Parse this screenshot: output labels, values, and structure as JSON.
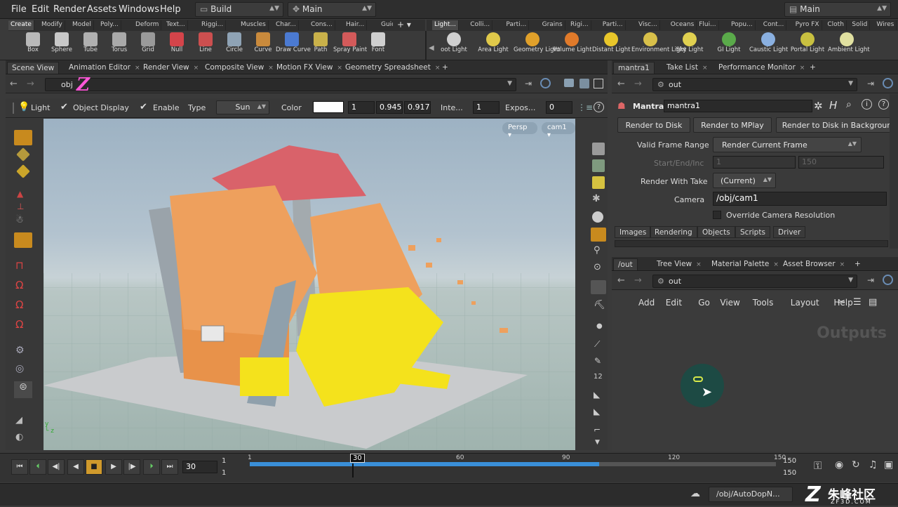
{
  "menu": [
    "File",
    "Edit",
    "Render",
    "Assets",
    "Windows",
    "Help"
  ],
  "desktop": {
    "value": "Build"
  },
  "context": {
    "value": "Main"
  },
  "desktop_right": {
    "value": "Main"
  },
  "shelf_tabs_left": [
    "Create",
    "Modify",
    "Model",
    "Poly...",
    "Deform",
    "Text...",
    "Riggi...",
    "Muscles",
    "Char...",
    "Cons...",
    "Hair...",
    "Guid..."
  ],
  "shelf_tabs_right": [
    "Light...",
    "Colli...",
    "Parti...",
    "Grains",
    "Rigi...",
    "Parti...",
    "Visc...",
    "Oceans",
    "Flui...",
    "Popu...",
    "Cont...",
    "Pyro FX",
    "Cloth",
    "Solid",
    "Wires"
  ],
  "tools_left": [
    {
      "label": "Box",
      "icon": "box-icon",
      "color": "#b9b9b9"
    },
    {
      "label": "Sphere",
      "icon": "sphere-icon",
      "color": "#c9c9c9"
    },
    {
      "label": "Tube",
      "icon": "tube-icon",
      "color": "#b0b0b0"
    },
    {
      "label": "Torus",
      "icon": "torus-icon",
      "color": "#a9a9a9"
    },
    {
      "label": "Grid",
      "icon": "grid-icon",
      "color": "#9a9a9a"
    },
    {
      "label": "Null",
      "icon": "null-icon",
      "color": "#d4444a"
    },
    {
      "label": "Line",
      "icon": "line-icon",
      "color": "#cc4f4f"
    },
    {
      "label": "Circle",
      "icon": "circle-icon",
      "color": "#8fa3b5"
    },
    {
      "label": "Curve",
      "icon": "curve-icon",
      "color": "#c98a3c"
    },
    {
      "label": "Draw Curve",
      "icon": "draw-curve-icon",
      "color": "#4b7ad1"
    },
    {
      "label": "Path",
      "icon": "path-icon",
      "color": "#c9b14a"
    },
    {
      "label": "Spray Paint",
      "icon": "spray-paint-icon",
      "color": "#d35a5a"
    },
    {
      "label": "Font",
      "icon": "font-icon",
      "color": "#cfcfcf"
    }
  ],
  "tools_right": [
    {
      "label": "oot Light",
      "icon": "spot-light-icon",
      "color": "#cfcfcf"
    },
    {
      "label": "Area Light",
      "icon": "area-light-icon",
      "color": "#e0c94a"
    },
    {
      "label": "Geometry Light",
      "icon": "geometry-light-icon",
      "color": "#e0a02a"
    },
    {
      "label": "Volume Light",
      "icon": "volume-light-icon",
      "color": "#e07a2a"
    },
    {
      "label": "Distant Light",
      "icon": "distant-light-icon",
      "color": "#e8c62a"
    },
    {
      "label": "Environment Light",
      "icon": "environment-light-icon",
      "color": "#d8c04a"
    },
    {
      "label": "Sky Light",
      "icon": "sky-light-icon",
      "color": "#e0d050"
    },
    {
      "label": "GI Light",
      "icon": "gi-light-icon",
      "color": "#5aaa4a"
    },
    {
      "label": "Caustic Light",
      "icon": "caustic-light-icon",
      "color": "#8ab0e0"
    },
    {
      "label": "Portal Light",
      "icon": "portal-light-icon",
      "color": "#c8c040"
    },
    {
      "label": "Ambient Light",
      "icon": "ambient-light-icon",
      "color": "#e0e0a0"
    }
  ],
  "left_tabs": [
    "Scene View",
    "Animation Editor",
    "Render View",
    "Composite View",
    "Motion FX View",
    "Geometry Spreadsheet"
  ],
  "left_path": "obj",
  "left_path_overlay": "Z",
  "light_bar": {
    "title": "Light",
    "object_display": "Object Display",
    "enable": "Enable",
    "type_label": "Type",
    "type_value": "Sun",
    "color_label": "Color",
    "color_r": "1",
    "color_g": "0.945",
    "color_b": "0.917",
    "intensity_label": "Inte...",
    "intensity_value": "1",
    "exposure_label": "Expos...",
    "exposure_value": "0"
  },
  "viewport": {
    "persp": "Persp",
    "cam": "cam1"
  },
  "right_top_tabs": [
    "mantra1",
    "Take List",
    "Performance Monitor"
  ],
  "right_top_path": "out",
  "mantra": {
    "type_label": "Mantra",
    "node_name": "mantra1",
    "buttons": [
      "Render to Disk",
      "Render to MPlay",
      "Render to Disk in Backgroun"
    ],
    "valid_frame_range_label": "Valid Frame Range",
    "valid_frame_range_value": "Render Current Frame",
    "start_end_label": "Start/End/Inc",
    "start_value": "1",
    "end_value": "150",
    "render_with_take_label": "Render With Take",
    "render_with_take_value": "(Current)",
    "camera_label": "Camera",
    "camera_value": "/obj/cam1",
    "override_label": "Override Camera Resolution",
    "subtabs": [
      "Images",
      "Rendering",
      "Objects",
      "Scripts",
      "Driver"
    ]
  },
  "right_bottom_tabs": [
    "/out",
    "Tree View",
    "Material Palette",
    "Asset Browser"
  ],
  "right_bottom_path": "out",
  "network_menu": [
    "Add",
    "Edit",
    "Go",
    "View",
    "Tools",
    "Layout",
    "Help"
  ],
  "network_watermark": "Outputs",
  "timeline": {
    "current_frame": "30",
    "start_frame": "1",
    "start_frame2": "1",
    "end_frame": "150",
    "end_frame2": "150",
    "ticks": [
      "1",
      "30",
      "60",
      "90",
      "120",
      "150"
    ],
    "ticks_values": [
      1,
      30,
      60,
      90,
      120,
      150
    ],
    "range_start": 1,
    "range_end": 150,
    "cached_end": 100,
    "current": 30
  },
  "status": {
    "path": "/obj/AutoDopN..."
  },
  "watermark": {
    "line1": "朱峰社区",
    "line2": "ZF3D.COM"
  }
}
